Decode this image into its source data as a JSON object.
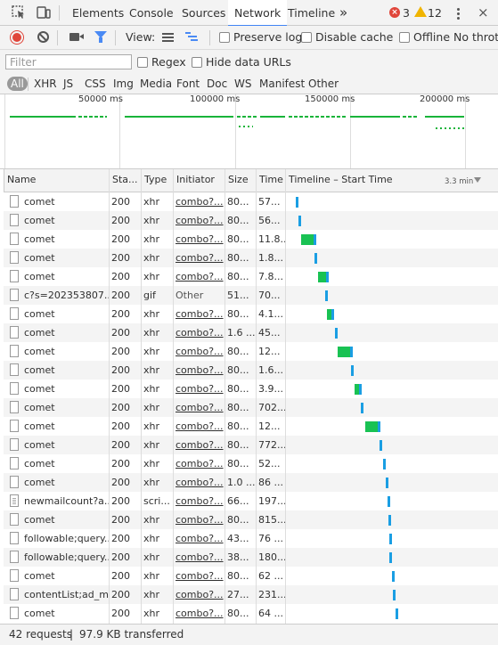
{
  "tabs": {
    "items": [
      "Elements",
      "Console",
      "Sources",
      "Network",
      "Timeline"
    ],
    "active": "Network",
    "more_label": "»",
    "error_count": "3",
    "warning_count": "12",
    "error_glyph": "×",
    "close_glyph": "×"
  },
  "toolbar": {
    "view_label": "View:",
    "preserve_log": "Preserve log",
    "disable_cache": "Disable cache",
    "offline": "Offline",
    "throttle": "No thrott"
  },
  "filter": {
    "placeholder": "Filter",
    "value": "",
    "regex": "Regex",
    "hide_data_urls": "Hide data URLs"
  },
  "type_filters": [
    "All",
    "XHR",
    "JS",
    "CSS",
    "Img",
    "Media",
    "Font",
    "Doc",
    "WS",
    "Manifest",
    "Other"
  ],
  "overview": {
    "ticks": [
      "50000 ms",
      "100000 ms",
      "150000 ms",
      "200000 ms"
    ]
  },
  "columns": {
    "name": "Name",
    "status": "Sta...",
    "type": "Type",
    "initiator": "Initiator",
    "size": "Size",
    "time": "Time",
    "timeline": "Timeline – Start Time",
    "timeline_scale": "3.3 min"
  },
  "requests": [
    {
      "name": "comet",
      "status": "200",
      "type": "xhr",
      "initiator": "combo?...",
      "size": "80...",
      "time": "57...",
      "icon": "file",
      "wait": 0,
      "recv": 0
    },
    {
      "name": "comet",
      "status": "200",
      "type": "xhr",
      "initiator": "combo?...",
      "size": "80...",
      "time": "56...",
      "icon": "file",
      "wait": 0,
      "recv": 0
    },
    {
      "name": "comet",
      "status": "200",
      "type": "xhr",
      "initiator": "combo?...",
      "size": "80...",
      "time": "11.8...",
      "icon": "file",
      "wait": 14,
      "recv": 0
    },
    {
      "name": "comet",
      "status": "200",
      "type": "xhr",
      "initiator": "combo?...",
      "size": "80...",
      "time": "1.8...",
      "icon": "file",
      "wait": 0,
      "recv": 0
    },
    {
      "name": "comet",
      "status": "200",
      "type": "xhr",
      "initiator": "combo?...",
      "size": "80...",
      "time": "7.8...",
      "icon": "file",
      "wait": 9,
      "recv": 0
    },
    {
      "name": "c?s=202353807...",
      "status": "200",
      "type": "gif",
      "initiator": "Other",
      "size": "51...",
      "time": "70...",
      "icon": "file",
      "wait": 0,
      "recv": 0
    },
    {
      "name": "comet",
      "status": "200",
      "type": "xhr",
      "initiator": "combo?...",
      "size": "80...",
      "time": "4.1...",
      "icon": "file",
      "wait": 5,
      "recv": 0
    },
    {
      "name": "comet",
      "status": "200",
      "type": "xhr",
      "initiator": "combo?...",
      "size": "1.6 ...",
      "time": "45...",
      "icon": "file",
      "wait": 0,
      "recv": 0
    },
    {
      "name": "comet",
      "status": "200",
      "type": "xhr",
      "initiator": "combo?...",
      "size": "80...",
      "time": "12...",
      "icon": "file",
      "wait": 14,
      "recv": 0
    },
    {
      "name": "comet",
      "status": "200",
      "type": "xhr",
      "initiator": "combo?...",
      "size": "80...",
      "time": "1.6...",
      "icon": "file",
      "wait": 0,
      "recv": 0
    },
    {
      "name": "comet",
      "status": "200",
      "type": "xhr",
      "initiator": "combo?...",
      "size": "80...",
      "time": "3.9...",
      "icon": "file",
      "wait": 5,
      "recv": 0
    },
    {
      "name": "comet",
      "status": "200",
      "type": "xhr",
      "initiator": "combo?...",
      "size": "80...",
      "time": "702...",
      "icon": "file",
      "wait": 0,
      "recv": 0
    },
    {
      "name": "comet",
      "status": "200",
      "type": "xhr",
      "initiator": "combo?...",
      "size": "80...",
      "time": "12...",
      "icon": "file",
      "wait": 14,
      "recv": 0
    },
    {
      "name": "comet",
      "status": "200",
      "type": "xhr",
      "initiator": "combo?...",
      "size": "80...",
      "time": "772...",
      "icon": "file",
      "wait": 0,
      "recv": 0
    },
    {
      "name": "comet",
      "status": "200",
      "type": "xhr",
      "initiator": "combo?...",
      "size": "80...",
      "time": "52...",
      "icon": "file",
      "wait": 0,
      "recv": 0
    },
    {
      "name": "comet",
      "status": "200",
      "type": "xhr",
      "initiator": "combo?...",
      "size": "1.0 ...",
      "time": "86 ...",
      "icon": "file",
      "wait": 0,
      "recv": 0
    },
    {
      "name": "newmailcount?a...",
      "status": "200",
      "type": "scri...",
      "initiator": "combo?...",
      "size": "66...",
      "time": "197...",
      "icon": "doc",
      "wait": 0,
      "recv": 0
    },
    {
      "name": "comet",
      "status": "200",
      "type": "xhr",
      "initiator": "combo?...",
      "size": "80...",
      "time": "815...",
      "icon": "file",
      "wait": 0,
      "recv": 0
    },
    {
      "name": "followable;query...",
      "status": "200",
      "type": "xhr",
      "initiator": "combo?...",
      "size": "43...",
      "time": "76 ...",
      "icon": "file",
      "wait": 0,
      "recv": 0
    },
    {
      "name": "followable;query...",
      "status": "200",
      "type": "xhr",
      "initiator": "combo?...",
      "size": "38...",
      "time": "180...",
      "icon": "file",
      "wait": 0,
      "recv": 0
    },
    {
      "name": "comet",
      "status": "200",
      "type": "xhr",
      "initiator": "combo?...",
      "size": "80...",
      "time": "62 ...",
      "icon": "file",
      "wait": 0,
      "recv": 0
    },
    {
      "name": "contentList;ad_m...",
      "status": "200",
      "type": "xhr",
      "initiator": "combo?...",
      "size": "27...",
      "time": "231...",
      "icon": "file",
      "wait": 0,
      "recv": 0
    },
    {
      "name": "comet",
      "status": "200",
      "type": "xhr",
      "initiator": "combo?...",
      "size": "80...",
      "time": "64 ...",
      "icon": "file",
      "wait": 0,
      "recv": 0
    }
  ],
  "status_bar": {
    "requests": "42 requests",
    "separator": "|",
    "transferred": "97.9 KB transferred"
  },
  "colors": {
    "accent": "#4285f4",
    "record": "#e0453a",
    "warning": "#f0b400",
    "waiting": "#19c253",
    "receiving": "#1a9ee3"
  }
}
